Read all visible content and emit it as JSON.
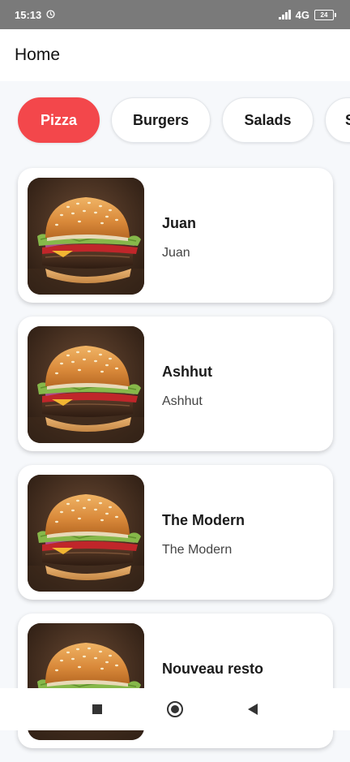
{
  "status_bar": {
    "time": "15:13",
    "network": "4G",
    "battery": "24",
    "icons": [
      "alarm-icon",
      "signal-icon",
      "battery-icon"
    ]
  },
  "header": {
    "title": "Home"
  },
  "categories": [
    {
      "label": "Pizza",
      "active": true
    },
    {
      "label": "Burgers",
      "active": false
    },
    {
      "label": "Salads",
      "active": false
    },
    {
      "label": "S",
      "active": false
    }
  ],
  "restaurants": [
    {
      "name": "Juan",
      "subtitle": "Juan"
    },
    {
      "name": "Ashhut",
      "subtitle": "Ashhut"
    },
    {
      "name": "The Modern",
      "subtitle": "The Modern"
    },
    {
      "name": "Nouveau resto",
      "subtitle": ""
    }
  ],
  "nav": {
    "icons": [
      "recent-apps-icon",
      "home-icon",
      "back-icon"
    ]
  },
  "colors": {
    "accent": "#f3474b",
    "status_bar": "#7a7a7a",
    "background": "#f6f8fb"
  }
}
